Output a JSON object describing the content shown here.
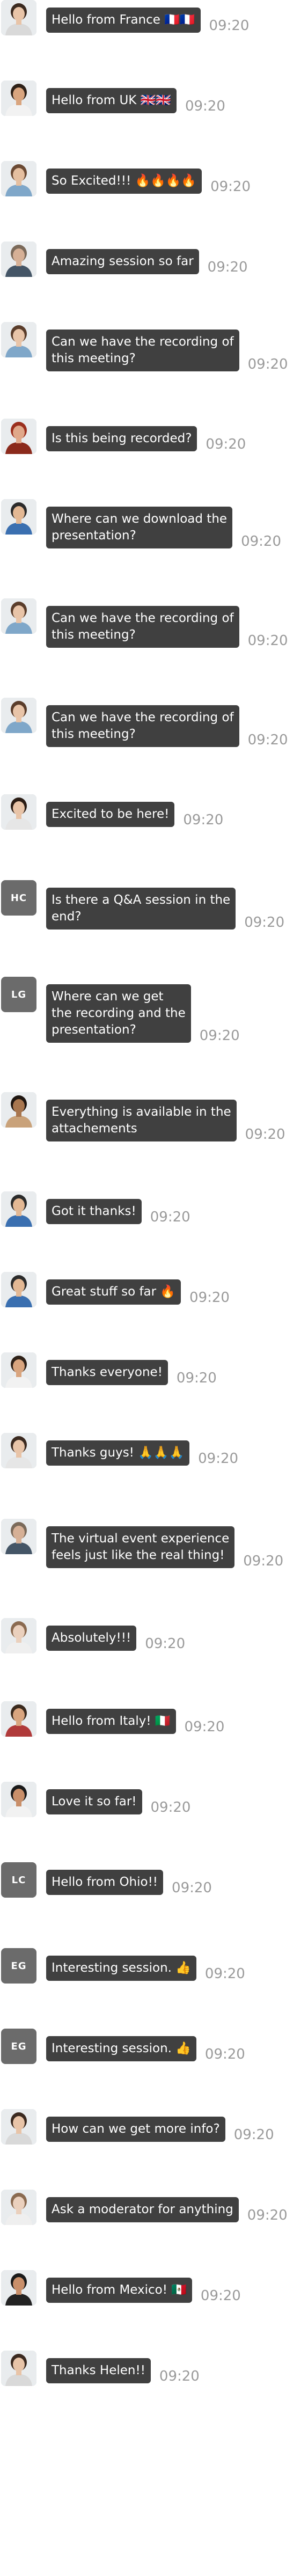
{
  "messages": [
    {
      "avatar": "photo",
      "text": "Hello from France 🇫🇷🇫🇷",
      "time": "09:20",
      "skin": "#e8c4a8",
      "hair": "#3b2a20",
      "shirt": "#d9d9d9"
    },
    {
      "avatar": "photo",
      "text": "Hello from UK 🇬🇧🇬🇧",
      "time": "09:20",
      "skin": "#d9a57f",
      "hair": "#2e2118",
      "shirt": "#f2f2f2"
    },
    {
      "avatar": "photo",
      "text": "So Excited!!! 🔥🔥🔥🔥",
      "time": "09:20",
      "skin": "#e5bfa0",
      "hair": "#6b4a34",
      "shirt": "#7fa7c9"
    },
    {
      "avatar": "photo",
      "text": "Amazing session so far",
      "time": "09:20",
      "skin": "#d6b096",
      "hair": "#7b6a5a",
      "shirt": "#445566"
    },
    {
      "avatar": "photo",
      "text": "Can we have the recording of\nthis meeting?",
      "time": "09:20",
      "skin": "#e8c4a8",
      "hair": "#5a3d2b",
      "shirt": "#7fa7c9"
    },
    {
      "avatar": "photo",
      "text": "Is this being recorded?",
      "time": "09:20",
      "skin": "#e0a88a",
      "hair": "#9b2f1e",
      "shirt": "#8b2a1c"
    },
    {
      "avatar": "photo",
      "text": "Where can we download the\npresentation?",
      "time": "09:20",
      "skin": "#e3b894",
      "hair": "#2b2b2b",
      "shirt": "#3a6fb0"
    },
    {
      "avatar": "photo",
      "text": "Can we have the recording of\nthis meeting?",
      "time": "09:20",
      "skin": "#e8c4a8",
      "hair": "#5a3d2b",
      "shirt": "#7fa7c9"
    },
    {
      "avatar": "photo",
      "text": "Can we have the recording of\nthis meeting?",
      "time": "09:20",
      "skin": "#e8c4a8",
      "hair": "#5a3d2b",
      "shirt": "#7fa7c9"
    },
    {
      "avatar": "photo",
      "text": "Excited to be here!",
      "time": "09:20",
      "skin": "#e8c4a8",
      "hair": "#2b1d15",
      "shirt": "#e6e6e6"
    },
    {
      "avatar": "initials",
      "initials": "HC",
      "text": "Is there a Q&A session in the\nend?",
      "time": "09:20"
    },
    {
      "avatar": "initials",
      "initials": "LG",
      "text": "Where can we get\nthe recording and the\npresentation?",
      "time": "09:20"
    },
    {
      "avatar": "photo",
      "text": "Everything is available in the\nattachements",
      "time": "09:20",
      "skin": "#a8764f",
      "hair": "#1e1510",
      "shirt": "#c9a27a"
    },
    {
      "avatar": "photo",
      "text": "Got it thanks!",
      "time": "09:20",
      "skin": "#e3b894",
      "hair": "#2b2b2b",
      "shirt": "#3a6fb0"
    },
    {
      "avatar": "photo",
      "text": "Great stuff so far 🔥",
      "time": "09:20",
      "skin": "#e3b894",
      "hair": "#2b2b2b",
      "shirt": "#3a6fb0"
    },
    {
      "avatar": "photo",
      "text": "Thanks everyone!",
      "time": "09:20",
      "skin": "#d9a57f",
      "hair": "#2e2118",
      "shirt": "#f2f2f2"
    },
    {
      "avatar": "photo",
      "text": "Thanks guys! 🙏🙏🙏",
      "time": "09:20",
      "skin": "#e8c4a8",
      "hair": "#3b2a20",
      "shirt": "#e6e6e6"
    },
    {
      "avatar": "photo",
      "text": "The virtual event experience\nfeels just like the real thing!",
      "time": "09:20",
      "skin": "#d6b096",
      "hair": "#7b6a5a",
      "shirt": "#445566"
    },
    {
      "avatar": "photo",
      "text": "Absolutely!!!",
      "time": "09:20",
      "skin": "#ead0bd",
      "hair": "#8a6a50",
      "shirt": "#efefef"
    },
    {
      "avatar": "photo",
      "text": "Hello from Italy! 🇮🇹",
      "time": "09:20",
      "skin": "#d9a57f",
      "hair": "#3a2a1e",
      "shirt": "#b03a3a"
    },
    {
      "avatar": "photo",
      "text": "Love it so far!",
      "time": "09:20",
      "skin": "#c98f6a",
      "hair": "#1a1a1a",
      "shirt": "#f2f2f2"
    },
    {
      "avatar": "initials",
      "initials": "LC",
      "text": "Hello from Ohio!!",
      "time": "09:20"
    },
    {
      "avatar": "initials",
      "initials": "EG",
      "text": "Interesting session. 👍",
      "time": "09:20"
    },
    {
      "avatar": "initials",
      "initials": "EG",
      "text": "Interesting session. 👍",
      "time": "09:20"
    },
    {
      "avatar": "photo",
      "text": "How can we get more info?",
      "time": "09:20",
      "skin": "#e8c4a8",
      "hair": "#3b2a20",
      "shirt": "#d9d9d9"
    },
    {
      "avatar": "photo",
      "text": "Ask a moderator for anything",
      "time": "09:20",
      "skin": "#ead0bd",
      "hair": "#8a6a50",
      "shirt": "#efefef"
    },
    {
      "avatar": "photo",
      "text": "Hello from Mexico! 🇲🇽",
      "time": "09:20",
      "skin": "#c98f6a",
      "hair": "#1a1a1a",
      "shirt": "#222222"
    },
    {
      "avatar": "photo",
      "text": "Thanks Helen!!",
      "time": "09:20",
      "skin": "#e8c4a8",
      "hair": "#3b2a20",
      "shirt": "#d9d9d9"
    }
  ]
}
